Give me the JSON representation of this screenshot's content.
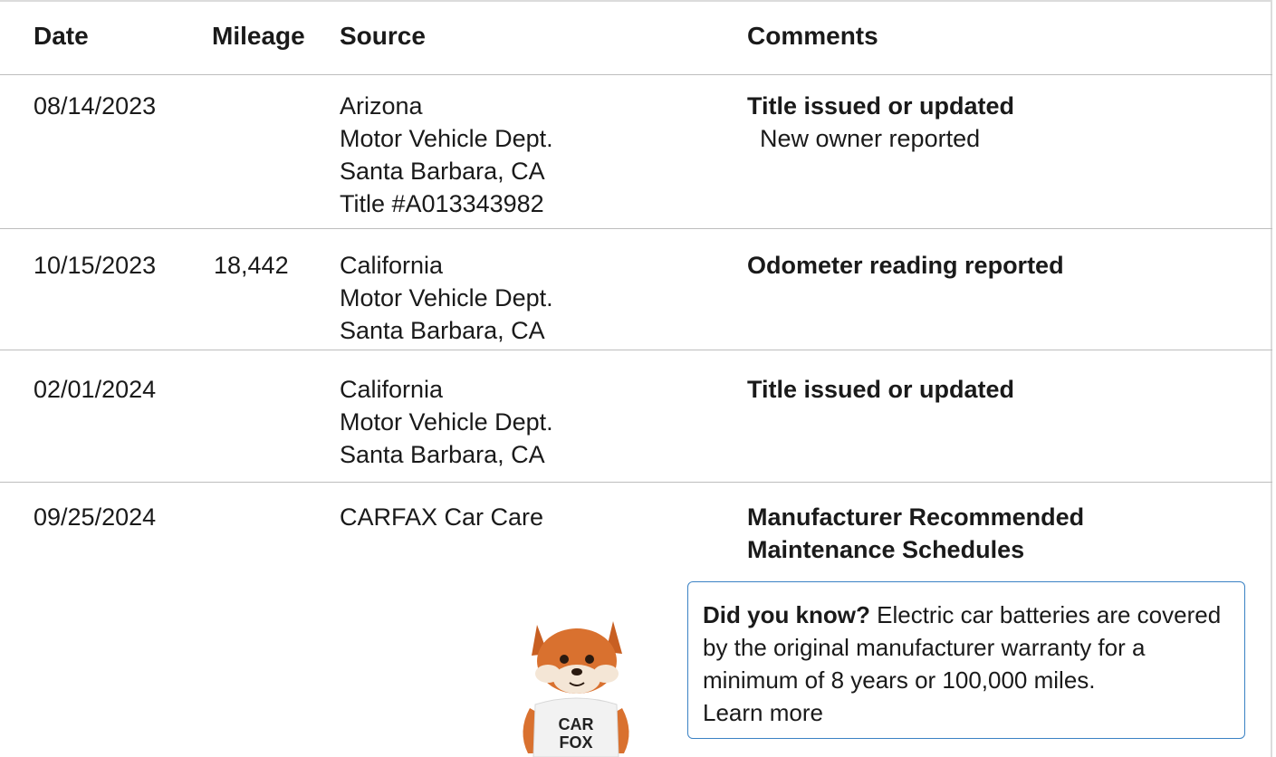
{
  "table": {
    "headers": {
      "date": "Date",
      "mileage": "Mileage",
      "source": "Source",
      "comments": "Comments"
    },
    "rows": [
      {
        "date": "08/14/2023",
        "mileage": "",
        "source": [
          "Arizona",
          "Motor Vehicle Dept.",
          "Santa Barbara, CA",
          "Title #A013343982"
        ],
        "comment_title": "Title issued or updated",
        "comment_detail": "New owner reported"
      },
      {
        "date": "10/15/2023",
        "mileage": "18,442",
        "source": [
          "California",
          "Motor Vehicle Dept.",
          "Santa Barbara, CA"
        ],
        "comment_title": "Odometer reading reported",
        "comment_detail": ""
      },
      {
        "date": "02/01/2024",
        "mileage": "",
        "source": [
          "California",
          "Motor Vehicle Dept.",
          "Santa Barbara, CA"
        ],
        "comment_title": "Title issued or updated",
        "comment_detail": ""
      },
      {
        "date": "09/25/2024",
        "mileage": "",
        "source": [
          "CARFAX Car Care"
        ],
        "comment_title_lines": [
          "Manufacturer Recommended",
          "Maintenance Schedules"
        ],
        "comment_detail": ""
      }
    ]
  },
  "tip_card": {
    "lead": "Did you know?",
    "body": " Electric car batteries are covered by the original manufacturer warranty for a minimum of 8 years or 100,000 miles.",
    "link": "Learn more"
  },
  "mascot": {
    "icon": "carfox-mascot-icon",
    "shirt_line1": "CAR",
    "shirt_line2": "FOX"
  },
  "colors": {
    "card_border": "#3b82c4",
    "divider": "#bdbdbd",
    "fox_orange": "#d9712f"
  }
}
